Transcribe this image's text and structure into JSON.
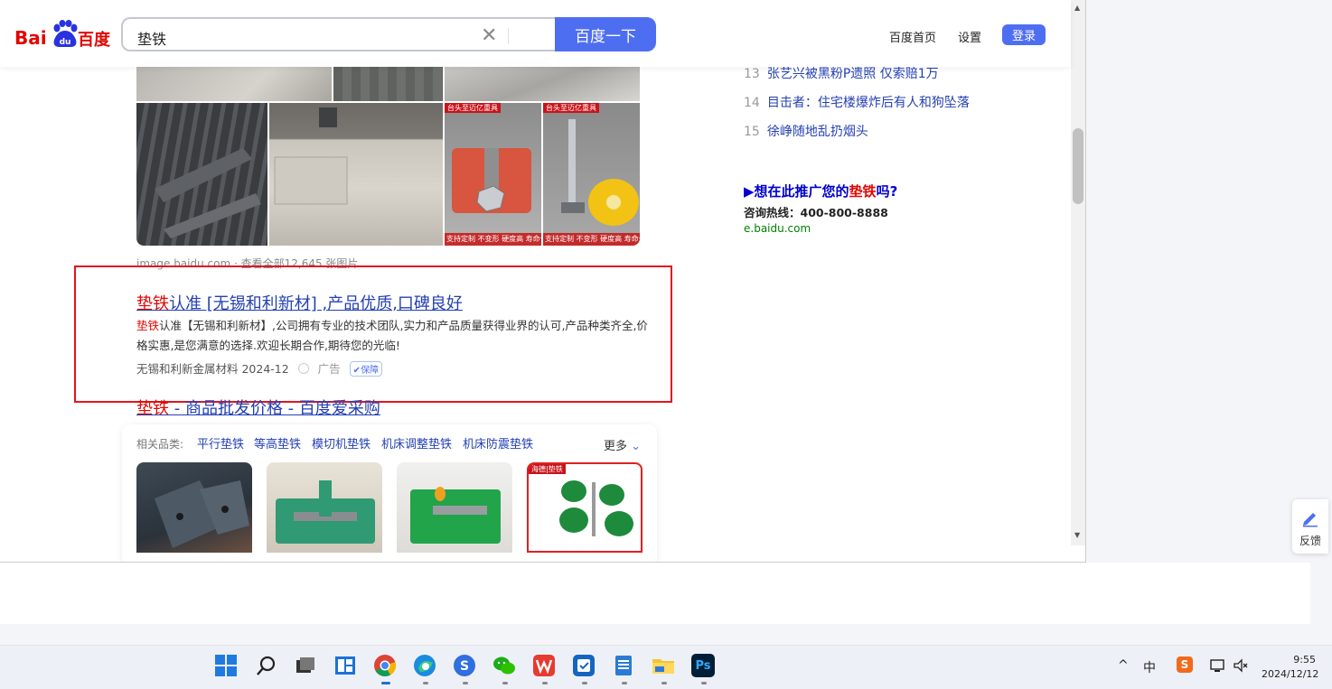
{
  "header": {
    "logo_left": "Bai",
    "logo_mid": "du",
    "logo_right": "百度",
    "search_value": "垫铁",
    "search_button": "百度一下",
    "home_link": "百度首页",
    "settings_link": "设置",
    "login_button": "登录"
  },
  "images": {
    "rail_text_1": "支持定制  不变形 硬度高 寿命长",
    "rail_text_2": "支持定制  不变形 硬度高 寿命长",
    "tag_1": "台头至迈亿重具",
    "tag_2": "台头至迈亿重具",
    "source_line": "image.baidu.com  ·  查看全部12,645 张图片"
  },
  "ad": {
    "title_keyword": "垫铁",
    "title_rest": "认准 [无锡和利新材] ,产品优质,口碑良好",
    "desc_keyword": "垫铁",
    "desc_rest": "认准【无锡和利新材】,公司拥有专业的技术团队,实力和产品质量获得业界的认可,产品种类齐全,价格实惠,是您满意的选择.欢迎长期合作,期待您的光临!",
    "meta_source": "无锡和利新金属材料 2024-12",
    "meta_ad": "广告",
    "meta_badge": "保障"
  },
  "result2": {
    "title_keyword": "垫铁",
    "title_rest": " - 商品批发价格 - 百度爱采购"
  },
  "related": {
    "label": "相关品类:",
    "chips": [
      "平行垫铁",
      "等高垫铁",
      "模切机垫铁",
      "机床调整垫铁",
      "机床防震垫铁"
    ],
    "more": "更多",
    "card4_tag": "海德|垫铁"
  },
  "hot_list": [
    {
      "num": "13",
      "text": "张艺兴被黑粉P遗照 仅索赔1万"
    },
    {
      "num": "14",
      "text": "目击者：住宅楼爆炸后有人和狗坠落"
    },
    {
      "num": "15",
      "text": "徐峥随地乱扔烟头"
    }
  ],
  "promo": {
    "prefix": "▶想在此推广您的",
    "keyword": "垫铁",
    "suffix": "吗?",
    "phone": "咨询热线：400-800-8888",
    "domain": "e.baidu.com"
  },
  "feedback": {
    "label": "反馈"
  },
  "taskbar": {
    "clock_time": "9:55",
    "clock_date": "2024/12/12",
    "ime": "中",
    "sogou": "S"
  },
  "colors": {
    "brand_blue": "#4e6ef2",
    "link_blue": "#2440b3",
    "keyword_red": "#e10602",
    "highlight_box": "#e0161f"
  }
}
